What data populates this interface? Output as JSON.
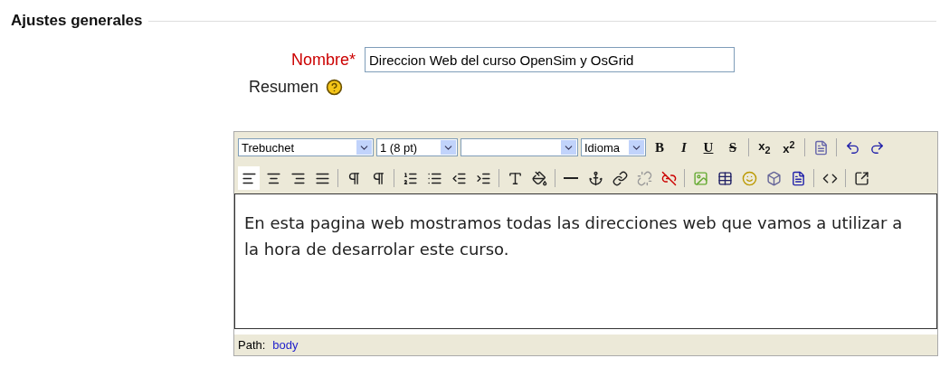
{
  "section": {
    "title": "Ajustes generales"
  },
  "name_field": {
    "label": "Nombre*",
    "value": "Direccion Web del curso OpenSim y OsGrid"
  },
  "summary": {
    "label": "Resumen"
  },
  "editor": {
    "selects": [
      {
        "value": "Trebuchet",
        "kind": "wide"
      },
      {
        "value": "1 (8 pt)",
        "kind": "narrow"
      },
      {
        "kind": "wide"
      },
      {
        "value": "Idioma",
        "kind": "narrow"
      }
    ],
    "format_buttons": [
      {
        "label": "B",
        "kind": "bold"
      },
      {
        "label": "I",
        "kind": "italic"
      },
      {
        "label": "U",
        "kind": "underline"
      },
      {
        "label": "S",
        "kind": "strike"
      }
    ],
    "script_buttons": [
      "x$_{2}$",
      "x$^{2}$"
    ],
    "alignment": [
      {
        "selected": true
      },
      {
        "selected": false
      },
      {
        "selected": false
      },
      {
        "selected": false
      }
    ],
    "content": "En esta pagina web mostramos todas las direcciones web que vamos a utilizar a la hora de desarrolar este curso.",
    "path_label": "Path:",
    "path_link": "body"
  }
}
